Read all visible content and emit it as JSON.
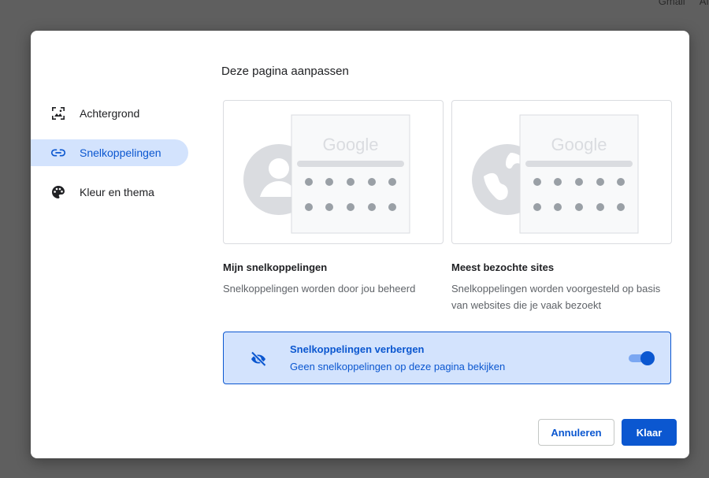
{
  "backdrop": {
    "links": [
      "Gmail",
      "Af"
    ]
  },
  "dialog": {
    "title": "Deze pagina aanpassen",
    "sidebar": {
      "items": [
        {
          "label": "Achtergrond",
          "icon": "image-icon",
          "active": false
        },
        {
          "label": "Snelkoppelingen",
          "icon": "link-icon",
          "active": true
        },
        {
          "label": "Kleur en thema",
          "icon": "palette-icon",
          "active": false
        }
      ]
    },
    "options": [
      {
        "title": "Mijn snelkoppelingen",
        "description": "Snelkoppelingen worden door jou beheerd",
        "preview_logo": "Google",
        "icon": "person-icon"
      },
      {
        "title": "Meest bezochte sites",
        "description": "Snelkoppelingen worden voorgesteld op basis van websites die je vaak bezoekt",
        "preview_logo": "Google",
        "icon": "globe-icon"
      }
    ],
    "hide_shortcuts": {
      "title": "Snelkoppelingen verbergen",
      "subtitle": "Geen snelkoppelingen op deze pagina bekijken",
      "enabled": true
    },
    "buttons": {
      "cancel": "Annuleren",
      "done": "Klaar"
    }
  },
  "colors": {
    "accent": "#0b57d0",
    "accent_bg": "#d3e3fd",
    "preview_gray": "#dadce0",
    "dot_gray": "#9aa0a6"
  }
}
